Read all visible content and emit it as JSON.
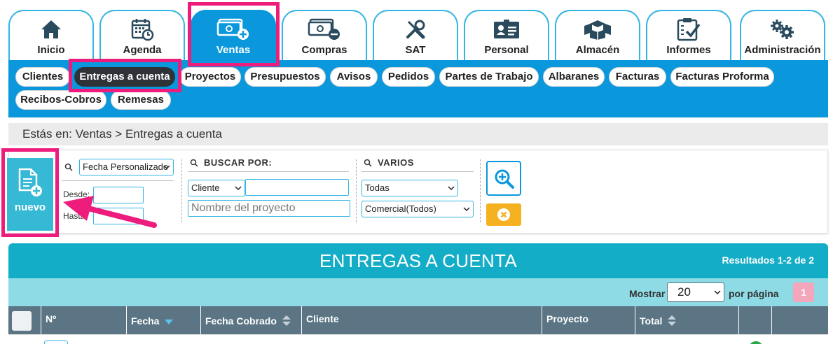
{
  "nav": {
    "tabs": [
      {
        "label": "Inicio",
        "icon": "home-icon"
      },
      {
        "label": "Agenda",
        "icon": "calendar-icon"
      },
      {
        "label": "Ventas",
        "icon": "cash-add-icon",
        "active": true
      },
      {
        "label": "Compras",
        "icon": "cash-remove-icon"
      },
      {
        "label": "SAT",
        "icon": "tools-icon"
      },
      {
        "label": "Personal",
        "icon": "id-card-icon"
      },
      {
        "label": "Almacén",
        "icon": "boxes-icon"
      },
      {
        "label": "Informes",
        "icon": "clipboard-check-icon"
      },
      {
        "label": "Administración",
        "icon": "gears-icon"
      }
    ]
  },
  "submenu": {
    "items": [
      {
        "label": "Clientes"
      },
      {
        "label": "Entregas a cuenta",
        "active": true
      },
      {
        "label": "Proyectos"
      },
      {
        "label": "Presupuestos"
      },
      {
        "label": "Avisos"
      },
      {
        "label": "Pedidos"
      },
      {
        "label": "Partes de Trabajo"
      },
      {
        "label": "Albaranes"
      },
      {
        "label": "Facturas"
      },
      {
        "label": "Facturas Proforma"
      },
      {
        "label": "Recibos-Cobros"
      },
      {
        "label": "Remesas"
      }
    ]
  },
  "breadcrumb": {
    "text": "Estás en: Ventas > Entregas a cuenta"
  },
  "filters": {
    "new_label": "nuevo",
    "date_select": "Fecha Personalizado",
    "desde_label": "Desde:",
    "hasta_label": "Hasta:",
    "search_heading": "BUSCAR POR:",
    "search_field_select": "Cliente",
    "search_value": "",
    "project_placeholder": "Nombre del proyecto",
    "varios_heading": "VARIOS",
    "varios_select": "Todas",
    "comercial_select": "Comercial(Todos)"
  },
  "results": {
    "title": "ENTREGAS A CUENTA",
    "count": "Resultados 1-2 de 2",
    "show_label": "Mostrar",
    "per_page_value": "20",
    "per_page_label": "por página",
    "page": "1"
  },
  "table": {
    "columns": [
      "Nº",
      "Fecha",
      "Fecha Cobrado",
      "Cliente",
      "Proyecto",
      "Total"
    ]
  },
  "colors": {
    "accent": "#0a97dc",
    "teal": "#14adc7",
    "highlight": "#ee1d7d",
    "table_header": "#5b7584"
  }
}
